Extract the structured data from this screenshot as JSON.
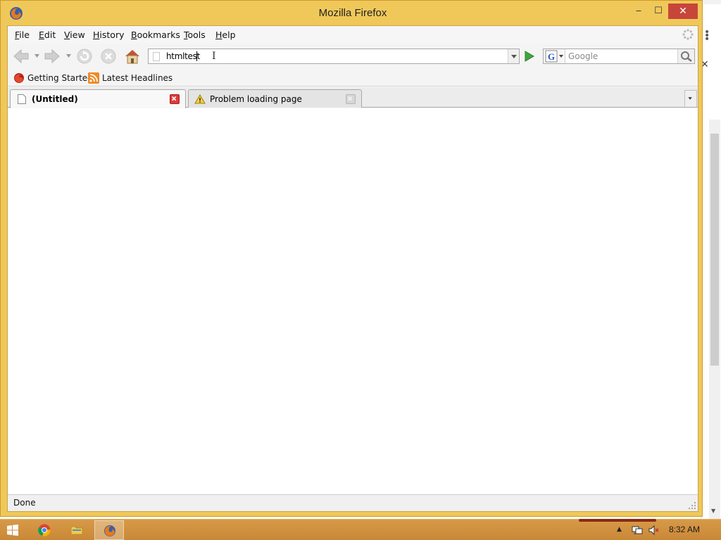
{
  "window": {
    "title": "Mozilla Firefox",
    "app_icon": "firefox-icon",
    "controls": {
      "minimize": "‒",
      "maximize": "☐",
      "close": "✕"
    }
  },
  "menu": {
    "items": [
      "File",
      "Edit",
      "View",
      "History",
      "Bookmarks",
      "Tools",
      "Help"
    ]
  },
  "nav": {
    "back": "back-arrow-icon",
    "forward": "forward-arrow-icon",
    "reload": "reload-icon",
    "stop": "stop-icon",
    "home": "home-icon",
    "url_value": "htmltest",
    "search_engine": "google-icon",
    "search_placeholder": "Google"
  },
  "bookmarks": {
    "items": [
      {
        "label": "Getting Started",
        "icon": "firefox-bookmark-icon"
      },
      {
        "label": "Latest Headlines",
        "icon": "rss-feed-icon"
      }
    ]
  },
  "tabs": [
    {
      "label": "(Untitled)",
      "active": true,
      "icon": "blank-page-icon"
    },
    {
      "label": "Problem loading page",
      "active": false,
      "icon": "warning-icon"
    }
  ],
  "status": {
    "text": "Done"
  },
  "taskbar": {
    "apps": [
      {
        "name": "Chrome",
        "icon": "chrome-icon",
        "active": false
      },
      {
        "name": "File Explorer",
        "icon": "folder-icon",
        "active": false
      },
      {
        "name": "Firefox",
        "icon": "firefox-icon",
        "active": true
      }
    ],
    "clock": "8:32 AM"
  },
  "colors": {
    "frame": "#f0c85a",
    "close_button": "#c7463a",
    "taskbar": "#d08f3e",
    "active_tab_close": "#de3b3b"
  }
}
